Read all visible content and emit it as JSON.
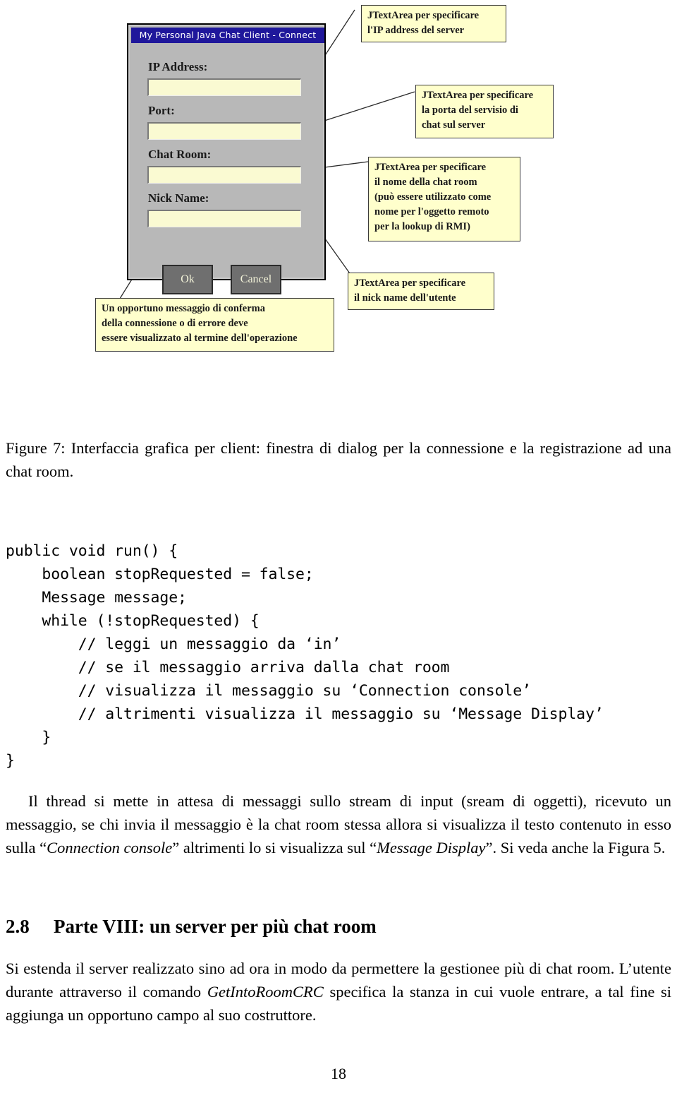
{
  "figure": {
    "dialog": {
      "title": "My Personal Java Chat Client - Connect",
      "fields": [
        {
          "label": "IP Address:",
          "value": ""
        },
        {
          "label": "Port:",
          "value": ""
        },
        {
          "label": "Chat Room:",
          "value": ""
        },
        {
          "label": "Nick Name:",
          "value": ""
        }
      ],
      "buttons": [
        {
          "label": "Ok"
        },
        {
          "label": "Cancel"
        }
      ]
    },
    "notes": [
      {
        "id": "note-ip",
        "text": "JTextArea per specificare\nl'IP address del server"
      },
      {
        "id": "note-port",
        "text": "JTextArea per specificare\nla porta del servisio di\nchat sul server"
      },
      {
        "id": "note-room",
        "text": "JTextArea per specificare\nil nome della chat room\n(può essere utilizzato come\nnome per l'oggetto remoto\nper la lookup di RMI)"
      },
      {
        "id": "note-nick",
        "text": "JTextArea per specificare\nil nick name dell'utente"
      },
      {
        "id": "note-confirm",
        "text": "Un opportuno messaggio di conferma\ndella connessione o di errore deve\nessere visualizzato al termine dell'operazione"
      }
    ]
  },
  "caption": "Figure 7: Interfaccia grafica per client: finestra di dialog per la connessione e la registrazione ad una chat room.",
  "code": "public void run() {\n    boolean stopRequested = false;\n    Message message;\n    while (!stopRequested) {\n        // leggi un messaggio da ‘in’\n        // se il messaggio arriva dalla chat room\n        // visualizza il messaggio su ‘Connection console’\n        // altrimenti visualizza il messaggio su ‘Message Display’\n    }\n}",
  "paragraphs": {
    "thread": {
      "part1": "Il thread si mette in attesa di messaggi sullo stream di input (sream di oggetti), ricevuto un messaggio, se chi invia il messaggio è la chat room stessa allora si visualizza il testo contenuto in esso sulla “",
      "italic1": "Connection console",
      "part2": "” altrimenti lo si visualizza sul “",
      "italic2": "Message Display",
      "part3": "”. Si veda anche la Figura 5."
    },
    "parte": {
      "part1": "Si estenda il server realizzato sino ad ora in modo da permettere la gestionee più di chat room. L’utente durante attraverso il comando ",
      "italic1": "GetIntoRoomCRC",
      "part2": " specifica la stanza in cui vuole entrare, a tal fine si aggiunga un opportuno campo al suo costruttore."
    }
  },
  "section": {
    "number": "2.8",
    "title": "Parte VIII: un server per più chat room"
  },
  "page_number": "18",
  "colors": {
    "titlebar": "#1f179b",
    "dialog_bg": "#b8b8b8",
    "field_bg": "#fafad2",
    "button_bg": "#6f6f6f",
    "note_bg": "#ffffcc"
  }
}
